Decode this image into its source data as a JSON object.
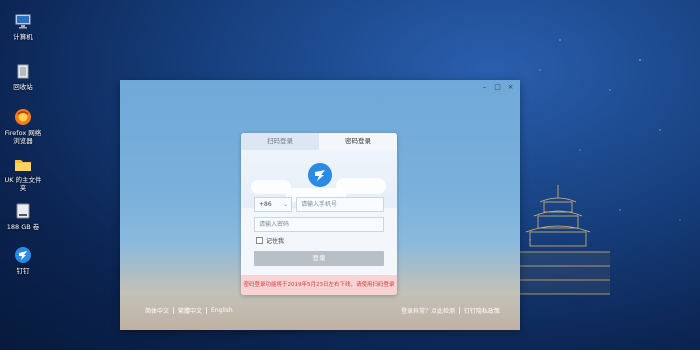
{
  "desktop": {
    "icons": [
      {
        "label": "计算机",
        "icon": "computer-icon"
      },
      {
        "label": "回收站",
        "icon": "trash-icon"
      },
      {
        "label": "Firefox 网络浏览器",
        "icon": "firefox-icon"
      },
      {
        "label": "UK 的主文件夹",
        "icon": "folder-icon"
      },
      {
        "label": "188 GB 卷",
        "icon": "drive-icon"
      },
      {
        "label": "钉钉",
        "icon": "dingtalk-icon"
      }
    ]
  },
  "window": {
    "controls": {
      "minimize": "–",
      "maximize": "□",
      "close": "×"
    },
    "tabs": [
      {
        "label": "扫码登录",
        "active": false
      },
      {
        "label": "密码登录",
        "active": true
      }
    ],
    "country_code": "+86",
    "phone_placeholder": "请输入手机号",
    "password_placeholder": "请输入密码",
    "remember_label": "记住我",
    "login_button": "登录",
    "warning": "密码登录功能将于2019年5月23日左右下线，请使用扫码登录",
    "languages": [
      "简体中文",
      "繁體中文",
      "English"
    ],
    "bottom_links": [
      "登录异常？点此检测",
      "钉钉隐私政策"
    ]
  },
  "colors": {
    "accent": "#2b8ae3",
    "warning_bg": "#f7d3d4",
    "warning_text": "#d23c3c"
  }
}
